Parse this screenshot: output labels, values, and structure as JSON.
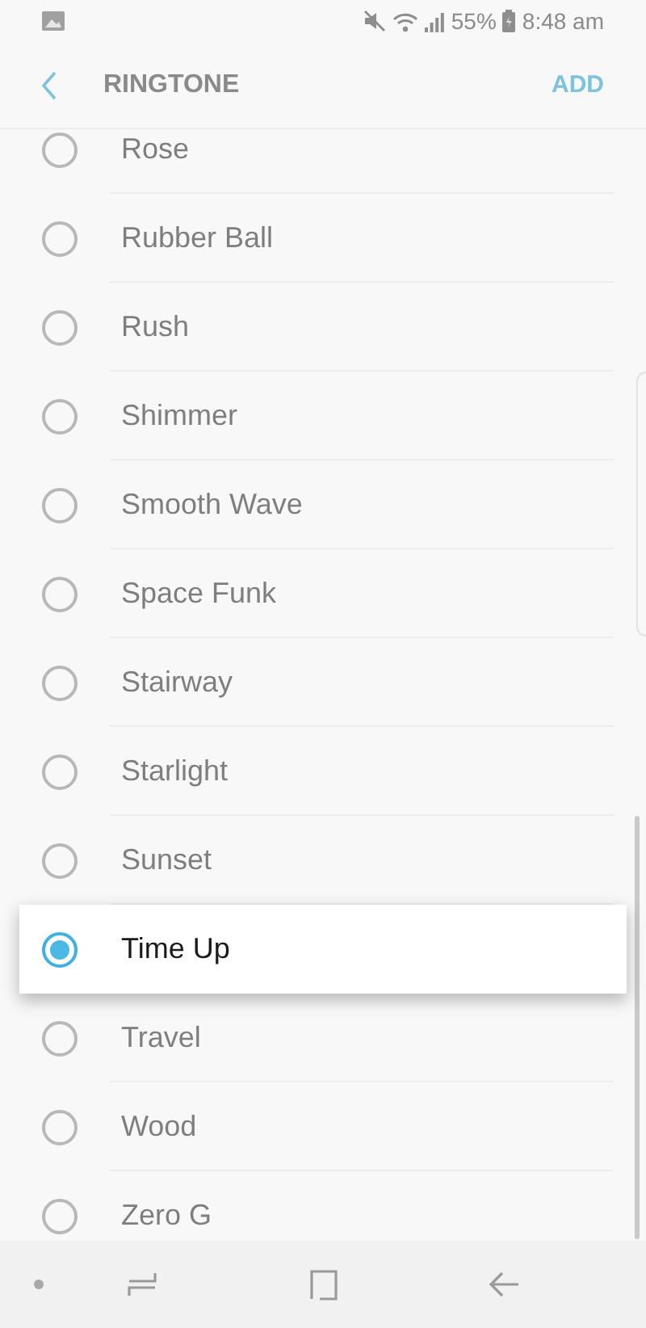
{
  "status_bar": {
    "battery_percent": "55%",
    "time": "8:48 am"
  },
  "header": {
    "title": "RINGTONE",
    "action": "ADD"
  },
  "ringtones": [
    {
      "name": "Rose",
      "selected": false
    },
    {
      "name": "Rubber Ball",
      "selected": false
    },
    {
      "name": "Rush",
      "selected": false
    },
    {
      "name": "Shimmer",
      "selected": false
    },
    {
      "name": "Smooth Wave",
      "selected": false
    },
    {
      "name": "Space Funk",
      "selected": false
    },
    {
      "name": "Stairway",
      "selected": false
    },
    {
      "name": "Starlight",
      "selected": false
    },
    {
      "name": "Sunset",
      "selected": false
    },
    {
      "name": "Time Up",
      "selected": true
    },
    {
      "name": "Travel",
      "selected": false
    },
    {
      "name": "Wood",
      "selected": false
    },
    {
      "name": "Zero G",
      "selected": false
    }
  ]
}
